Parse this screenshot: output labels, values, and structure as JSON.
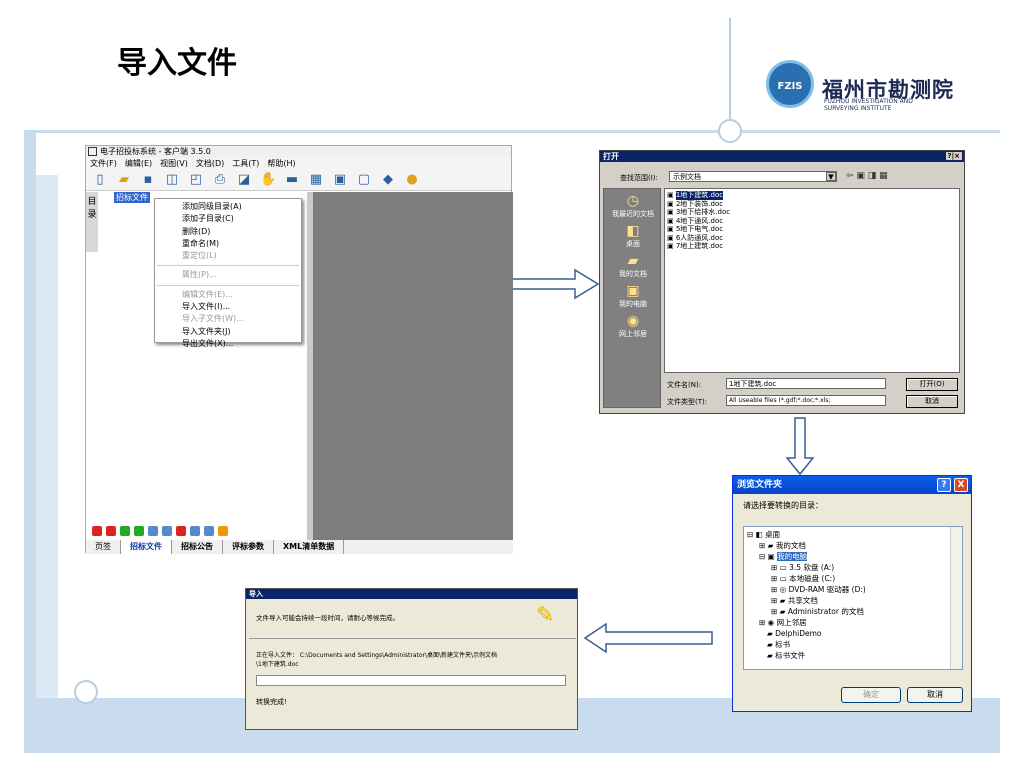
{
  "slide": {
    "title": "导入文件",
    "logo_mark": "FZIS",
    "logo_cn": "福州市勘测院",
    "logo_en_1": "FUZHOU INVESTIGATION AND",
    "logo_en_2": "SURVEYING INSTITUTE"
  },
  "app": {
    "title": "电子招投标系统 - 客户端 3.5.0",
    "menu": [
      "文件(F)",
      "编辑(E)",
      "视图(V)",
      "文档(D)",
      "工具(T)",
      "帮助(H)"
    ],
    "left_tab": "目录",
    "tree_item": "招标文件",
    "context_menu": [
      "添加同级目录(A)",
      "添加子目录(C)",
      "删除(D)",
      "重命名(M)",
      "重定位(L)",
      "属性(P)...",
      "编辑文件(E)...",
      "导入文件(I)...",
      "导入子文件(W)...",
      "导入文件夹(J)",
      "导出文件(X)..."
    ],
    "bottom_tabs": [
      "页签",
      "招标文件",
      "招标公告",
      "评标参数",
      "XML清单数据"
    ]
  },
  "open_dialog": {
    "title": "打开",
    "title_buttons": "?|×",
    "look_in_label": "查找范围(I):",
    "look_in_value": "示例文档",
    "places": [
      "我最近的文档",
      "桌面",
      "我的文档",
      "我的电脑",
      "网上邻居"
    ],
    "files": [
      "1地下建筑.doc",
      "2地下装饰.doc",
      "3地下给排水.doc",
      "4地下通风.doc",
      "5地下电气.doc",
      "6人防通风.doc",
      "7地上建筑.doc"
    ],
    "filename_label": "文件名(N):",
    "filename_value": "1地下建筑.doc",
    "filetype_label": "文件类型(T):",
    "filetype_value": "All Useable files (*.gdf;*.doc;*.xls;",
    "open_button": "打开(O)",
    "cancel_button": "取消"
  },
  "browse_dialog": {
    "title": "浏览文件夹",
    "help_button": "?",
    "close_button": "X",
    "prompt": "请选择要转换的目录：",
    "tree": [
      "桌面",
      "我的文档",
      "我的电脑",
      "3.5 软盘 (A:)",
      "本地磁盘 (C:)",
      "DVD-RAM 驱动器 (D:)",
      "共享文档",
      "Administrator 的文档",
      "网上邻居",
      "DelphiDemo",
      "标书",
      "标书文件"
    ],
    "ok_button": "确定",
    "cancel_button": "取消"
  },
  "import_dialog": {
    "title": "导入",
    "message": "文件导入可能会持续一段时间，请耐心等候完成。",
    "path_line1": "正在导入文件： C:\\Documents and Settings\\Administrator\\桌面\\新建文件夹\\示例文档",
    "path_line2": "\\1地下建筑.doc",
    "status": "转换完成!"
  }
}
